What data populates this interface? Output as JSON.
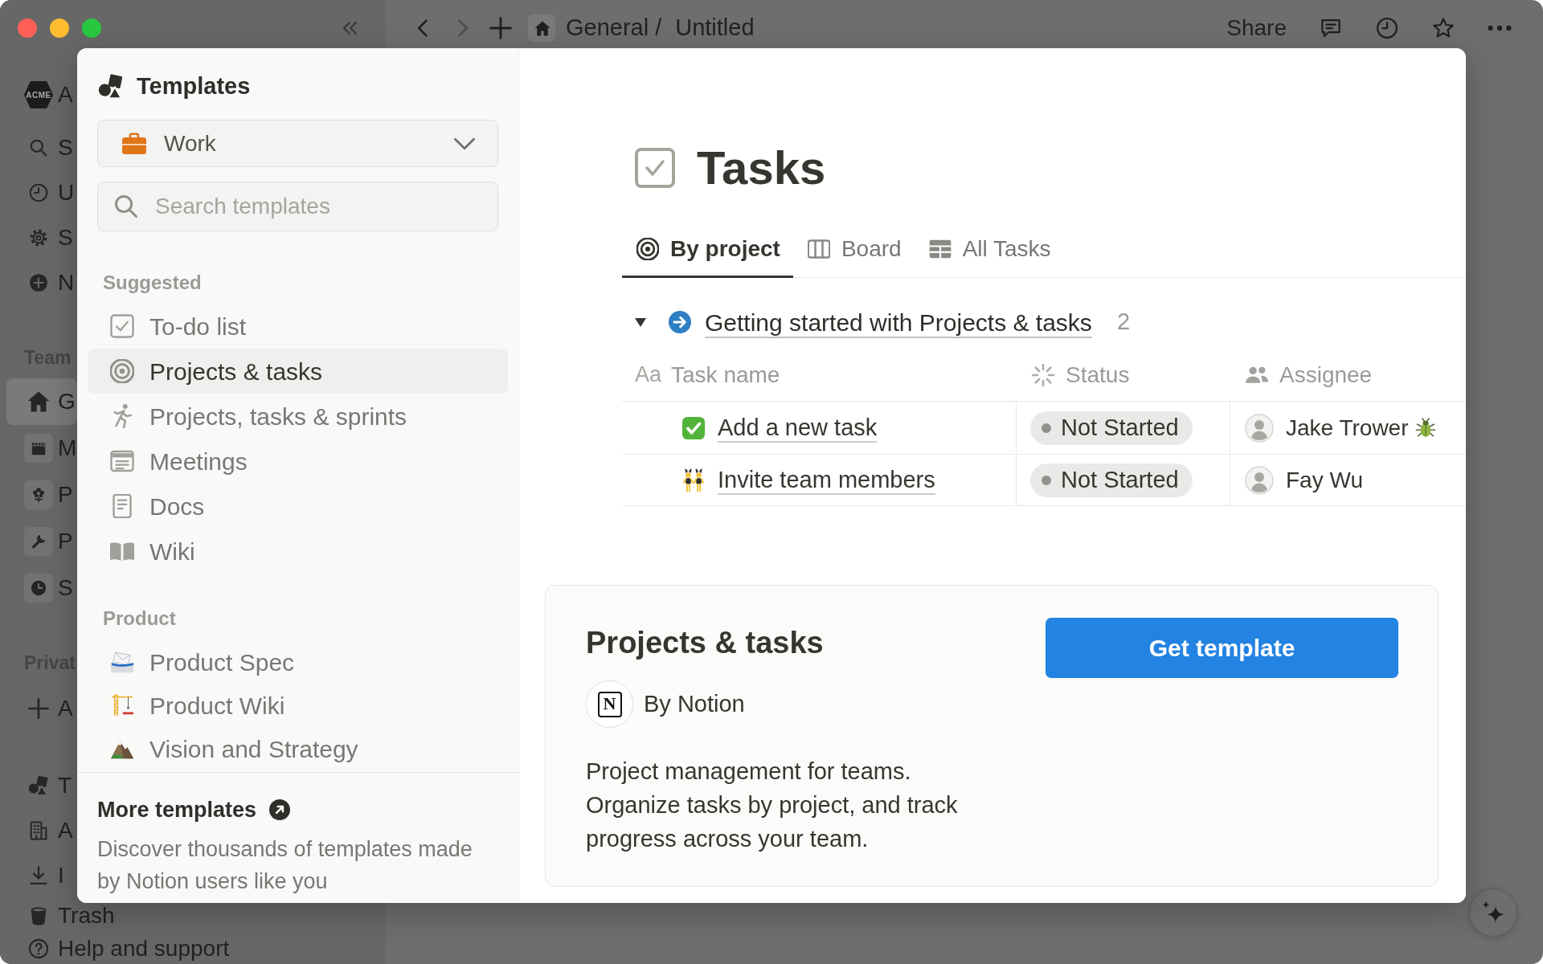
{
  "app": {
    "workspace": {
      "logo_text": "ACME",
      "name": "A"
    },
    "nav_items": [
      {
        "label": "S"
      },
      {
        "label": "U"
      },
      {
        "label": "S"
      },
      {
        "label": "N"
      }
    ],
    "teamspaces": {
      "label": "Team",
      "items": [
        {
          "label": "G",
          "selected": true
        },
        {
          "label": "M",
          "selected": false
        },
        {
          "label": "P",
          "selected": false
        },
        {
          "label": "P",
          "selected": false
        },
        {
          "label": "S",
          "selected": false
        }
      ]
    },
    "private": {
      "label": "Privat",
      "add_label": "A"
    },
    "footer_items": [
      {
        "label": "T"
      },
      {
        "label": "A"
      },
      {
        "label": "I"
      },
      {
        "label": "Trash"
      },
      {
        "label": "Help and support"
      }
    ]
  },
  "topbar": {
    "nav_buttons": [
      {
        "disabled": false
      },
      {
        "disabled": true
      }
    ],
    "breadcrumb": [
      {
        "label": "General"
      },
      {
        "label": "Untitled"
      }
    ],
    "separator": "/",
    "share": "Share"
  },
  "templates": {
    "title": "Templates",
    "category": "Work",
    "search": {
      "placeholder": "Search templates"
    },
    "sections": [
      {
        "label": "Suggested",
        "items": [
          {
            "label": "To-do list",
            "selected": false
          },
          {
            "label": "Projects & tasks",
            "selected": true
          },
          {
            "label": "Projects, tasks & sprints",
            "selected": false
          },
          {
            "label": "Meetings",
            "selected": false
          },
          {
            "label": "Docs",
            "selected": false
          },
          {
            "label": "Wiki",
            "selected": false
          }
        ]
      },
      {
        "label": "Product",
        "items": [
          {
            "label": "Product Spec",
            "selected": false
          },
          {
            "label": "Product Wiki",
            "selected": false
          },
          {
            "label": "Vision and Strategy",
            "selected": false
          }
        ]
      }
    ],
    "more": {
      "title": "More templates",
      "description": "Discover thousands of templates made\nby Notion users like you"
    }
  },
  "preview": {
    "title": "Tasks",
    "tabs": [
      {
        "label": "By project",
        "selected": true
      },
      {
        "label": "Board",
        "selected": false
      },
      {
        "label": "All Tasks",
        "selected": false
      }
    ],
    "group": {
      "title": "Getting started with Projects & tasks",
      "count": "2",
      "expanded": true
    },
    "table": {
      "columns": [
        {
          "label": "Task name",
          "type_label": "Aa"
        },
        {
          "label": "Status"
        },
        {
          "label": "Assignee"
        }
      ],
      "rows": [
        {
          "task": "Add a new task",
          "status": "Not Started",
          "assignee": "Jake Trower",
          "assignee_emoji": true
        },
        {
          "task": "Invite team members",
          "status": "Not Started",
          "assignee": "Fay Wu",
          "assignee_emoji": false
        }
      ]
    }
  },
  "details": {
    "title": "Projects & tasks",
    "logo_text": "N",
    "author": "By Notion",
    "description": "Project management for teams.\nOrganize tasks by project, and track\nprogress across your team.",
    "button": "Get template"
  }
}
